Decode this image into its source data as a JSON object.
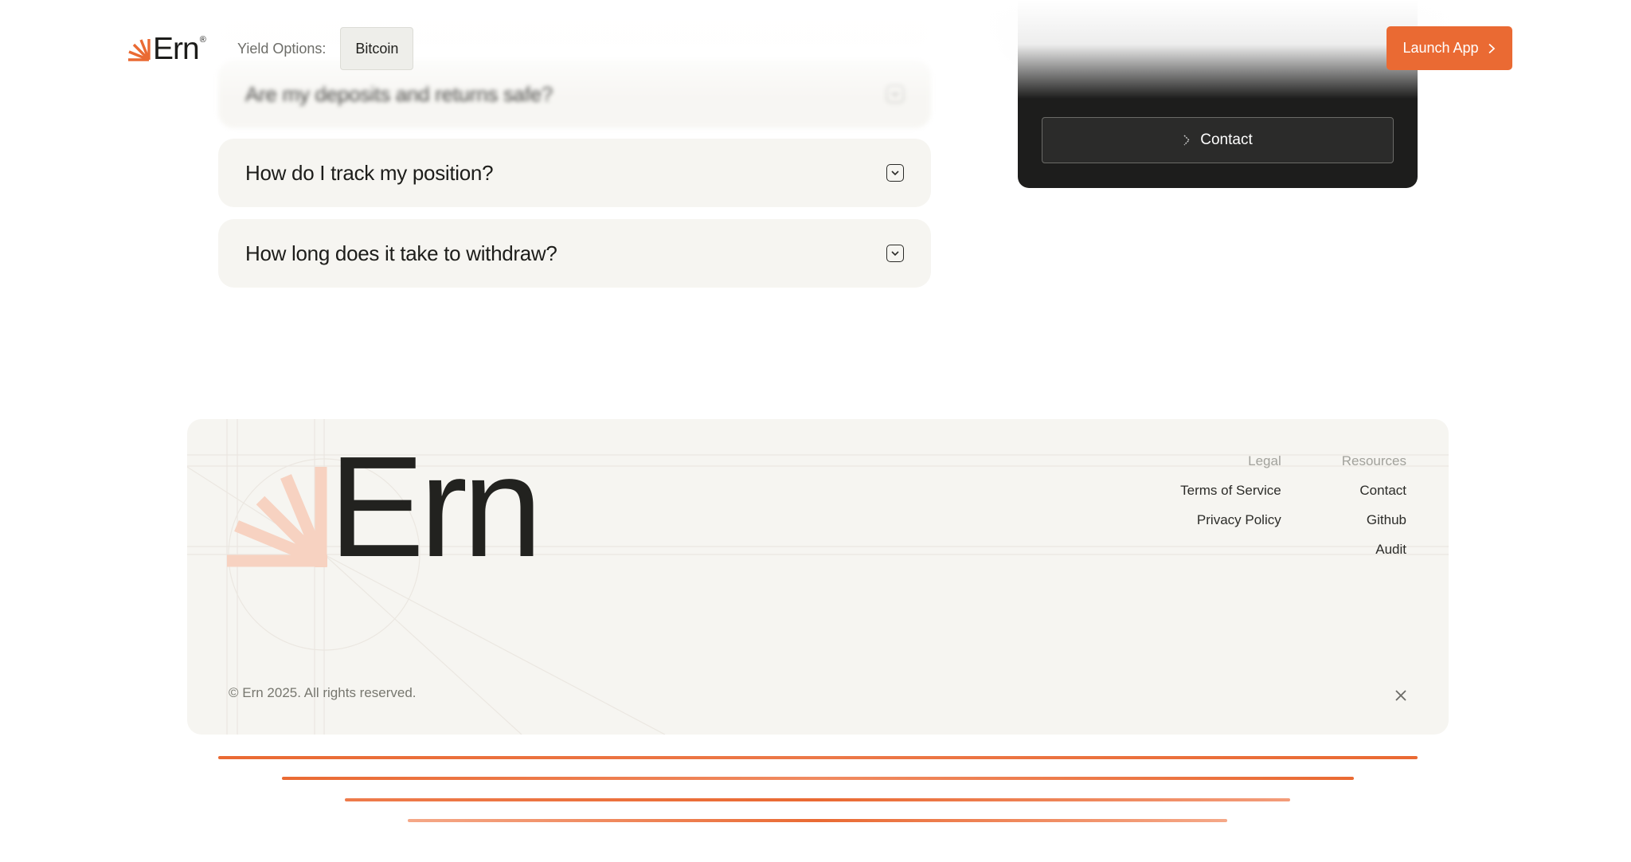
{
  "header": {
    "brand_name": "Ern",
    "brand_registered": "®",
    "yield_label": "Yield Options:",
    "yield_selected": "Bitcoin",
    "launch_label": "Launch App"
  },
  "faq": {
    "items": [
      {
        "question": "Are my deposits and returns safe?",
        "state": "collapsed"
      },
      {
        "question": "How do I track my position?",
        "state": "collapsed"
      },
      {
        "question": "How long does it take to withdraw?",
        "state": "collapsed"
      }
    ]
  },
  "contact_card": {
    "button_label": "Contact"
  },
  "footer": {
    "logo_word": "Ern",
    "legal": {
      "heading": "Legal",
      "links": [
        "Terms of Service",
        "Privacy Policy"
      ]
    },
    "resources": {
      "heading": "Resources",
      "links": [
        "Contact",
        "Github",
        "Audit"
      ]
    },
    "copyright": "© Ern 2025. All rights reserved."
  },
  "colors": {
    "accent": "#ea6a33",
    "dark_card": "#1d1d1c",
    "surface": "#f6f5f1",
    "text": "#1f1f1c"
  },
  "icons": {
    "brand": "ern-sunburst-icon",
    "launch": "chevron-right-icon",
    "faq_toggle": "chevron-down-icon",
    "contact": "chevron-right-icon",
    "social": "x-icon"
  }
}
